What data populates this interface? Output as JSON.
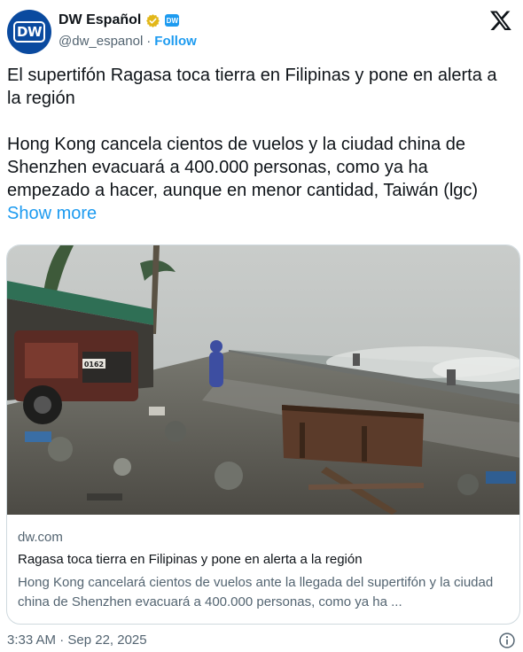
{
  "author": {
    "display_name": "DW Español",
    "handle": "@dw_espanol",
    "separator": "·",
    "follow_label": "Follow",
    "avatar_text": "DW",
    "affiliate_badge_text": "DW"
  },
  "tweet": {
    "paragraph1": "El supertifón Ragasa toca tierra en Filipinas y pone en alerta a la región",
    "paragraph2": "Hong Kong cancela cientos de vuelos y la ciudad china de Shenzhen evacuará a 400.000 personas, como ya ha empezado a hacer, aunque en menor cantidad, Taiwán (lgc)",
    "show_more_label": "Show more"
  },
  "card": {
    "domain": "dw.com",
    "title": "Ragasa toca tierra en Filipinas y pone en alerta a la región",
    "description": "Hong Kong cancelará cientos de vuelos ante la llegada del supertifón y la ciudad china de Shenzhen evacuará a 400.000 personas, como ya ha ...",
    "image_sign_text": "0162"
  },
  "footer": {
    "timestamp": "3:33 AM · Sep 22, 2025"
  },
  "colors": {
    "accent": "#1d9bf0",
    "verified": "#e2b719",
    "brand": "#0a4a9f"
  }
}
